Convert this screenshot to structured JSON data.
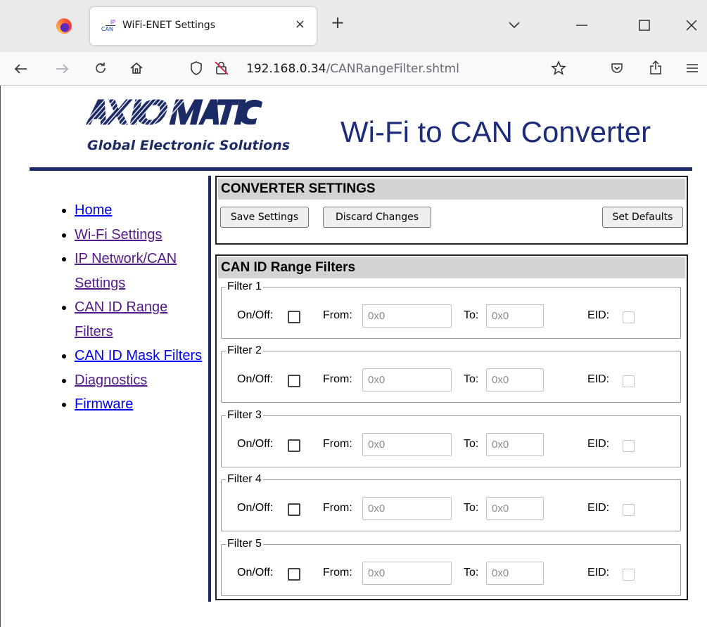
{
  "browser": {
    "tab_title": "WiFi-ENET Settings",
    "tab_icon_top": "IP",
    "tab_icon_bottom": "CAN",
    "close_glyph": "×",
    "new_tab_glyph": "+",
    "url_host": "192.168.0.34",
    "url_path": "/CANRangeFilter.shtml"
  },
  "header": {
    "logo_tagline": "Global Electronic Solutions",
    "logo_word": "AXIOMATIC",
    "title": "Wi-Fi to CAN Converter"
  },
  "menu": {
    "items": [
      {
        "label": "Home"
      },
      {
        "label": "Wi-Fi Settings"
      },
      {
        "label": "IP Network/CAN Settings"
      },
      {
        "label": "CAN ID Range Filters"
      },
      {
        "label": "CAN ID Mask Filters"
      },
      {
        "label": "Diagnostics"
      },
      {
        "label": "Firmware"
      }
    ]
  },
  "converter": {
    "heading": "CONVERTER SETTINGS",
    "save_label": "Save Settings",
    "discard_label": "Discard Changes",
    "defaults_label": "Set Defaults"
  },
  "range_filters": {
    "heading": "CAN ID Range Filters",
    "onoff_label": "On/Off:",
    "from_label": "From:",
    "to_label": "To:",
    "eid_label": "EID:",
    "filters": [
      {
        "legend": "Filter 1",
        "from_placeholder": "0x0",
        "to_placeholder": "0x0",
        "enabled": false,
        "eid": false
      },
      {
        "legend": "Filter 2",
        "from_placeholder": "0x0",
        "to_placeholder": "0x0",
        "enabled": false,
        "eid": false
      },
      {
        "legend": "Filter 3",
        "from_placeholder": "0x0",
        "to_placeholder": "0x0",
        "enabled": false,
        "eid": false
      },
      {
        "legend": "Filter 4",
        "from_placeholder": "0x0",
        "to_placeholder": "0x0",
        "enabled": false,
        "eid": false
      },
      {
        "legend": "Filter 5",
        "from_placeholder": "0x0",
        "to_placeholder": "0x0",
        "enabled": false,
        "eid": false
      }
    ]
  },
  "colors": {
    "brand_navy": "#1c2b66",
    "link": "#0000ee",
    "visited_link": "#551a8b",
    "panel_header": "#d3d3d3"
  }
}
